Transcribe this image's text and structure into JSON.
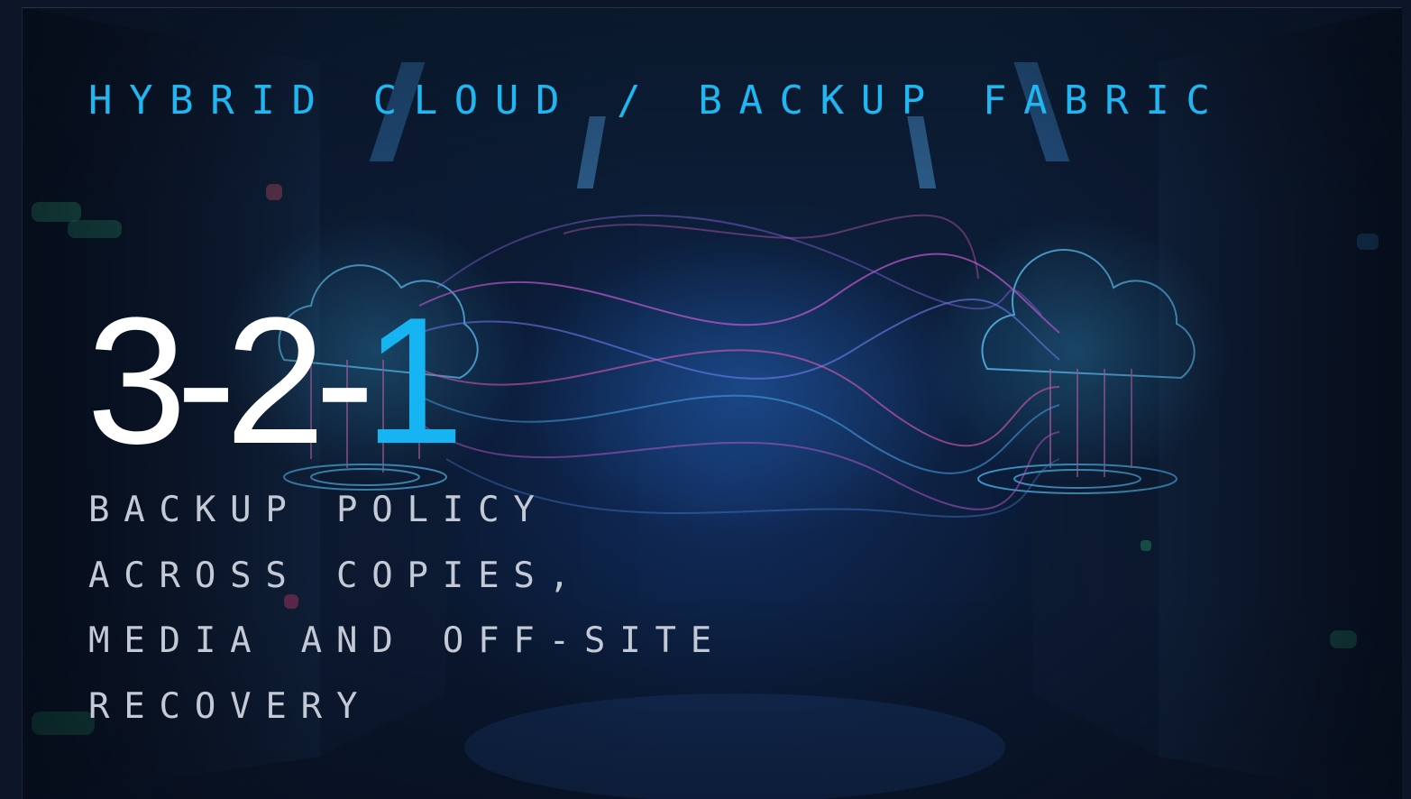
{
  "slide": {
    "eyebrow": "HYBRID CLOUD / BACKUP FABRIC",
    "hero_prefix": "3-2-",
    "hero_accent": "1",
    "subtitle_lines": [
      "BACKUP POLICY",
      "ACROSS COPIES,",
      "MEDIA AND OFF-SITE",
      "RECOVERY"
    ],
    "colors": {
      "accent": "#16b4f3",
      "eyebrow": "#1fb6f2",
      "hero": "#ffffff",
      "subtitle": "#c3cad6",
      "background": "#0b1a33"
    },
    "background_image": "server-room-with-two-clouds-and-data-streams"
  }
}
